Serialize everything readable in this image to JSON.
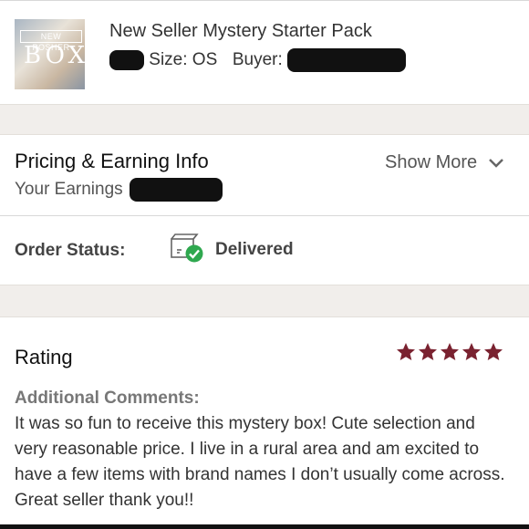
{
  "product": {
    "title": "New Seller Mystery Starter Pack",
    "size_label": "Size: OS",
    "buyer_label": "Buyer:",
    "thumb_text_top": "NEW POSHER",
    "thumb_text_main": "BOX"
  },
  "pricing": {
    "title": "Pricing & Earning Info",
    "earnings_label": "Your Earnings",
    "show_more": "Show More"
  },
  "order": {
    "status_label": "Order Status:",
    "status_value": "Delivered"
  },
  "rating": {
    "title": "Rating",
    "stars": 5,
    "comments_label": "Additional Comments:",
    "comments": "It was so fun to receive this mystery box! Cute selection and very reasonable price. I live in a rural area and am excited to have a few items with brand names I don’t usually come across. Great seller thank you!!"
  },
  "colors": {
    "star": "#7a2230",
    "band": "#f1eeeb",
    "delivered_check": "#2fa84f"
  },
  "icons": {
    "box": "box-icon",
    "check": "check-icon",
    "chevron": "chevron-down-icon",
    "star": "star-icon"
  }
}
